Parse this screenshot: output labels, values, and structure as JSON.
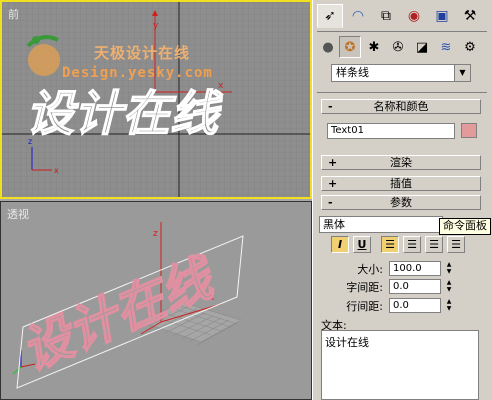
{
  "viewports": {
    "front": {
      "label": "前"
    },
    "perspective": {
      "label": "透视"
    }
  },
  "watermark": {
    "chinese": "天极设计在线",
    "url": "Design.yesky.com"
  },
  "scene_text": "设计在线",
  "command_panel": {
    "tabs": [
      "create-icon",
      "modify-icon",
      "hierarchy-icon",
      "motion-icon",
      "display-icon",
      "utilities-icon"
    ],
    "subcategories": [
      "geometry-icon",
      "shapes-icon",
      "lights-icon",
      "cameras-icon",
      "helpers-icon",
      "spacewarps-icon",
      "systems-icon"
    ],
    "category_dropdown": "样条线",
    "rollouts": {
      "name_color": {
        "sign": "-",
        "title": "名称和颜色"
      },
      "rendering": {
        "sign": "+",
        "title": "渲染"
      },
      "interpolation": {
        "sign": "+",
        "title": "插值"
      },
      "parameters": {
        "sign": "-",
        "title": "参数"
      }
    },
    "object_name": "Text01",
    "object_color": "#e29a9a",
    "font": "黑体",
    "tooltip": "命令面板",
    "format_buttons": {
      "italic": "I",
      "underline": "U"
    },
    "size": {
      "label": "大小:",
      "value": "100.0"
    },
    "kerning": {
      "label": "字间距:",
      "value": "0.0"
    },
    "leading": {
      "label": "行间距:",
      "value": "0.0"
    },
    "text_label": "文本:",
    "text_value": "设计在线"
  }
}
